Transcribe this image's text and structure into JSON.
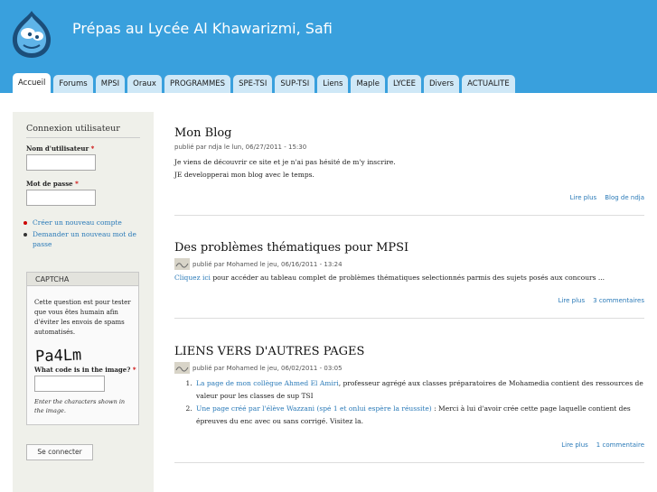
{
  "site": {
    "name": "Prépas au Lycée Al Khawarizmi, Safi"
  },
  "tabs": [
    {
      "label": "Accueil",
      "active": true
    },
    {
      "label": "Forums"
    },
    {
      "label": "MPSI"
    },
    {
      "label": "Oraux"
    },
    {
      "label": "PROGRAMMES"
    },
    {
      "label": "SPE-TSI"
    },
    {
      "label": "SUP-TSI"
    },
    {
      "label": "Liens"
    },
    {
      "label": "Maple"
    },
    {
      "label": "LYCEE"
    },
    {
      "label": "Divers"
    },
    {
      "label": "ACTUALITE"
    }
  ],
  "login": {
    "title": "Connexion utilisateur",
    "username_label": "Nom d'utilisateur",
    "password_label": "Mot de passe",
    "required_mark": "*",
    "links": [
      "Créer un nouveau compte",
      "Demander un nouveau mot de passe"
    ],
    "submit_label": "Se connecter"
  },
  "captcha": {
    "title": "CAPTCHA",
    "description": "Cette question est pour tester que vous êtes humain afin d'éviter les envois de spams automatisés.",
    "image_text": "Pa4Lm",
    "question": "What code is in the image?",
    "hint": "Enter the characters shown in the image."
  },
  "posts": [
    {
      "title": "Mon Blog",
      "meta": "publié par ndja le lun, 06/27/2011 - 15:30",
      "lines": [
        "Je viens de découvrir ce site et je n'ai pas hésité de m'y inscrire.",
        "JE developperai mon blog avec le temps."
      ],
      "links": [
        "Lire plus",
        "Blog de ndja"
      ]
    },
    {
      "title": "Des problèmes thématiques pour MPSI",
      "meta": "publié par Mohamed le jeu, 06/16/2011 - 13:24",
      "link_text": "Cliquez ici",
      "text": " pour accéder au tableau complet de problèmes thématiques selectionnés parmis des sujets posés aux concours ...",
      "links": [
        "Lire plus",
        "3 commentaires"
      ]
    },
    {
      "title": "LIENS VERS D'AUTRES PAGES",
      "meta": "publié par Mohamed le jeu, 06/02/2011 - 03:05",
      "items": [
        {
          "link": "La page de mon collègue Ahmed El Amiri",
          "text": ", professeur agrégé aux classes préparatoires de Mohamedia contient des ressources de valeur pour les classes de sup TSI"
        },
        {
          "link": "Une page créé par l'élève Wazzani (spé 1 et onlui espère la réussite)",
          "text": " : Merci à lui d'avoir crée cette page laquelle contient des épreuves du enc avec ou sans corrigé. Visitez la."
        }
      ],
      "links": [
        "Lire plus",
        "1 commentaire"
      ]
    }
  ],
  "colors": {
    "header": "#39a0dd",
    "link": "#2a7ab8",
    "sidebar": "#eff0ea"
  }
}
